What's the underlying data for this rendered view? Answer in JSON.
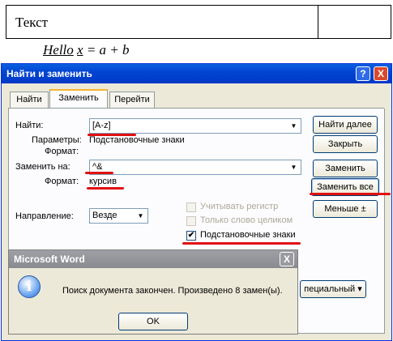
{
  "document": {
    "table_cell_text": "Текст",
    "formula_hello": "Hello",
    "formula_x": "x",
    "formula_rest": " = a + b"
  },
  "dialog": {
    "title": "Найти и заменить",
    "help_button": "?",
    "close_button": "X",
    "tabs": [
      {
        "label": "Найти",
        "active": false
      },
      {
        "label": "Заменить",
        "active": true
      },
      {
        "label": "Перейти",
        "active": false
      }
    ],
    "find_label": "Найти:",
    "find_value": "[А-z]",
    "params_label": "Параметры:",
    "params_value": "Подстановочные знаки",
    "format_label": "Формат:",
    "replace_label": "Заменить на:",
    "replace_value": "^&",
    "replace_format_label": "Формат:",
    "replace_format_value": "курсив",
    "direction_label": "Направление:",
    "direction_value": "Везде",
    "checkboxes": [
      {
        "label": "Учитывать регистр",
        "checked": false,
        "enabled": false
      },
      {
        "label": "Только слово целиком",
        "checked": false,
        "enabled": false
      },
      {
        "label": "Подстановочные знаки",
        "checked": true,
        "enabled": true
      }
    ],
    "buttons": {
      "find_next": "Найти далее",
      "close": "Закрыть",
      "replace": "Заменить",
      "replace_all": "Заменить все",
      "less": "Меньше ±",
      "special": "пециальный ▾"
    }
  },
  "message_box": {
    "title": "Microsoft Word",
    "close_button": "X",
    "icon": "info-icon",
    "text": "Поиск документа закончен.  Произведено 8 замен(ы).",
    "ok_label": "OK"
  },
  "colors": {
    "annotation_red": "#e01010",
    "titlebar_blue": "#0245d3",
    "dialog_face": "#ece9d8"
  }
}
